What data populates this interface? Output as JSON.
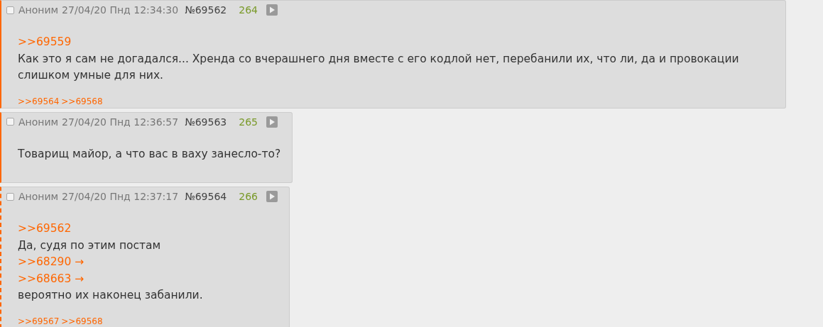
{
  "posts": [
    {
      "dashed": false,
      "checked": false,
      "name": "Аноним",
      "date": "27/04/20 Пнд 12:34:30",
      "number": "№69562",
      "count": "264",
      "body": [
        {
          "kind": "link",
          "text": ">>69559"
        },
        {
          "kind": "text",
          "text": "Как это я сам не догадался... Хренда со вчерашнего дня вместе с его кодлой нет, перебанили их, что ли, да и провокации слишком умные для них."
        }
      ],
      "replies": [
        ">>69564",
        ">>69568"
      ]
    },
    {
      "dashed": false,
      "checked": false,
      "name": "Аноним",
      "date": "27/04/20 Пнд 12:36:57",
      "number": "№69563",
      "count": "265",
      "body": [
        {
          "kind": "text",
          "text": "Товарищ майор, а что вас в ваху занесло-то?"
        }
      ]
    },
    {
      "dashed": true,
      "checked": false,
      "name": "Аноним",
      "date": "27/04/20 Пнд 12:37:17",
      "number": "№69564",
      "count": "266",
      "body": [
        {
          "kind": "link",
          "text": ">>69562"
        },
        {
          "kind": "text",
          "text": "Да, судя по этим постам"
        },
        {
          "kind": "link",
          "text": ">>68290 →"
        },
        {
          "kind": "link",
          "text": ">>68663 →"
        },
        {
          "kind": "text",
          "text": "вероятно их наконец забанили."
        }
      ],
      "replies": [
        ">>69567",
        ">>69568"
      ]
    }
  ]
}
